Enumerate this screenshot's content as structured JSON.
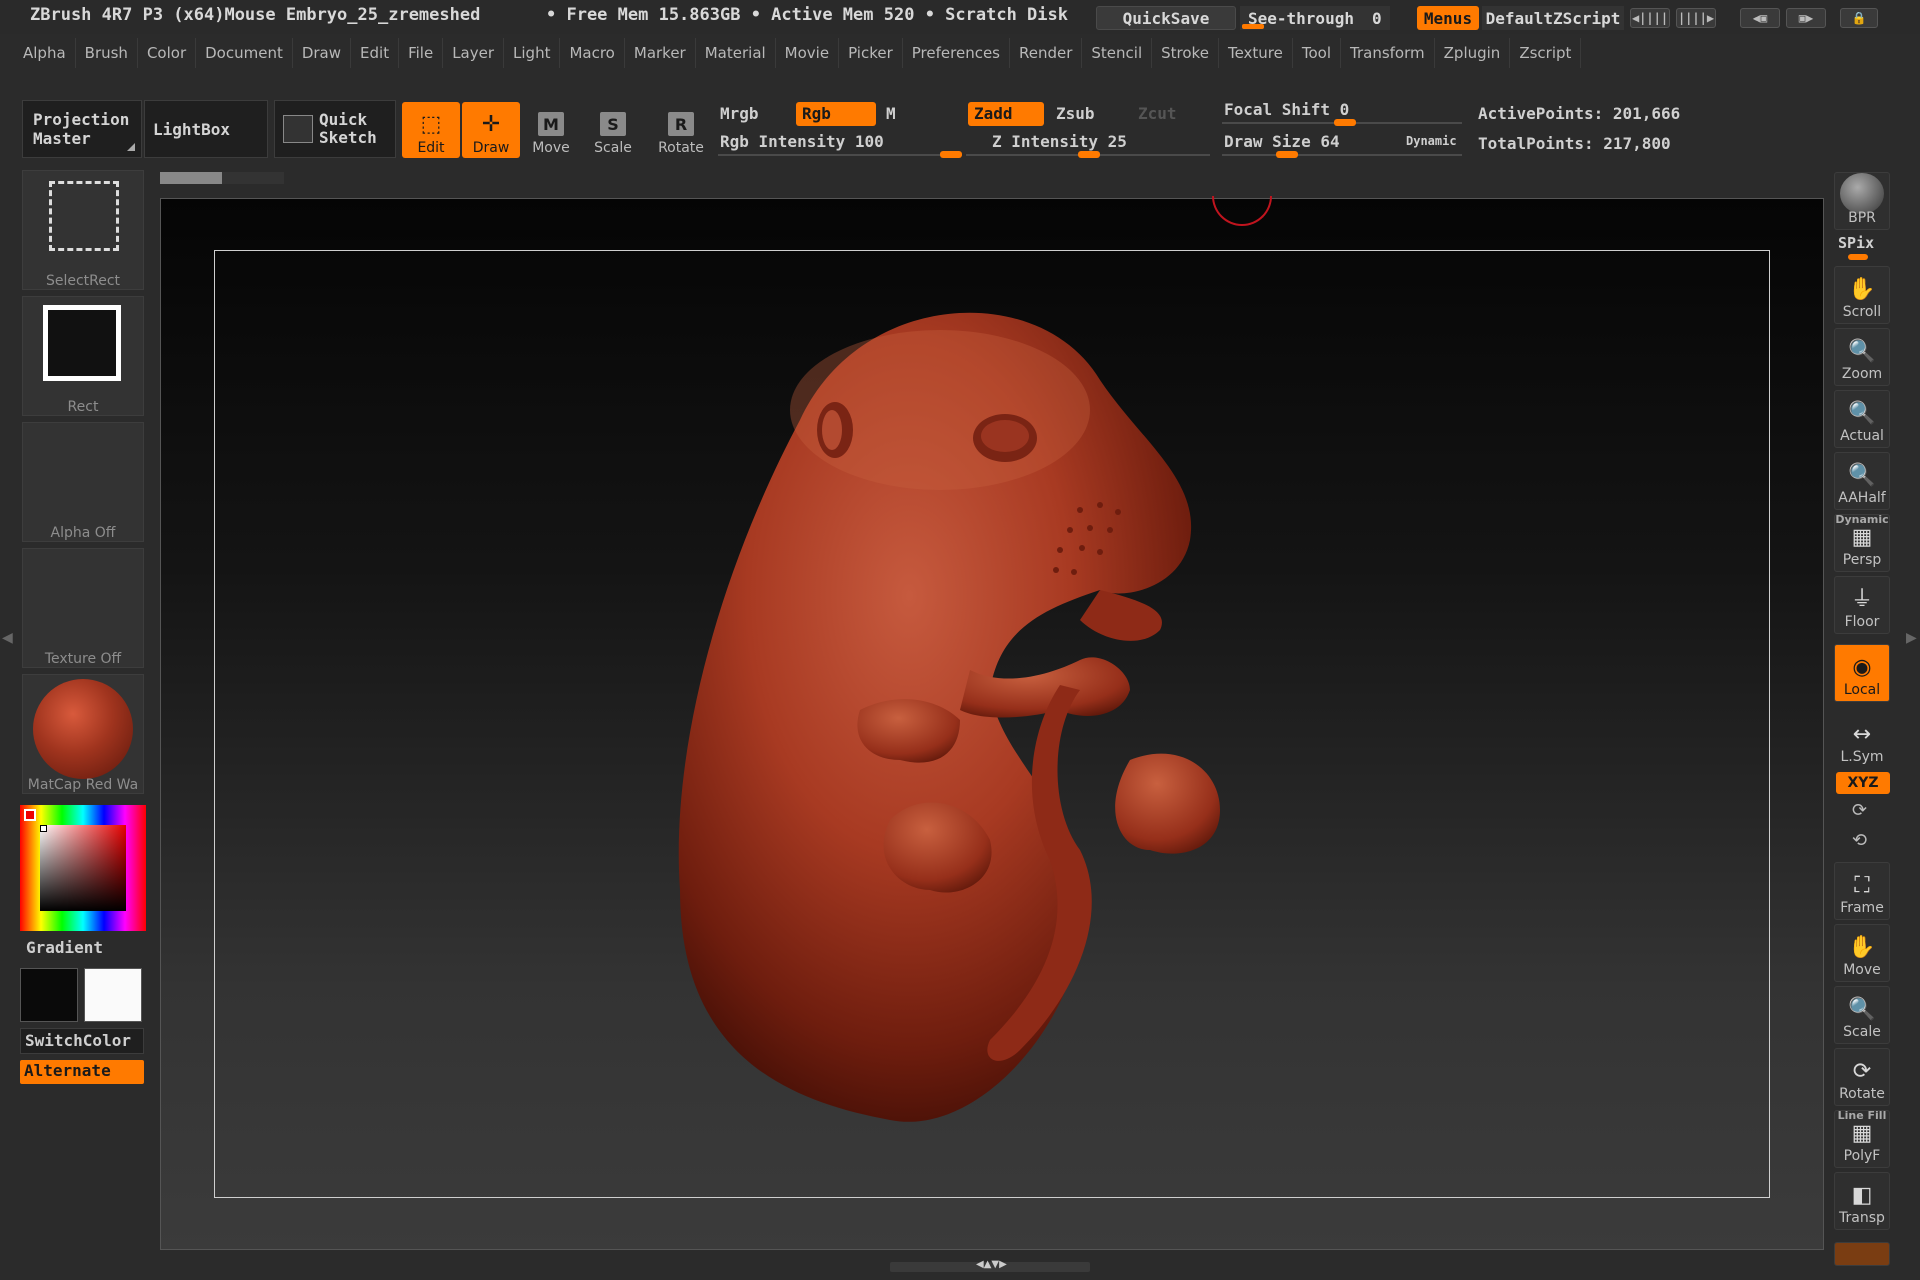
{
  "titlebar": {
    "app_title": "ZBrush 4R7 P3 (x64)Mouse Embryo_25_zremeshed",
    "memory": "• Free Mem 15.863GB • Active Mem 520 • Scratch Disk",
    "quicksave": "QuickSave",
    "see_through_label": "See-through",
    "see_through_value": "0",
    "menus": "Menus",
    "default_script": "DefaultZScript",
    "colors": {
      "accent": "#ff7a00",
      "background": "#2a2a2a"
    }
  },
  "menu": [
    "Alpha",
    "Brush",
    "Color",
    "Document",
    "Draw",
    "Edit",
    "File",
    "Layer",
    "Light",
    "Macro",
    "Marker",
    "Material",
    "Movie",
    "Picker",
    "Preferences",
    "Render",
    "Stencil",
    "Stroke",
    "Texture",
    "Tool",
    "Transform",
    "Zplugin",
    "Zscript"
  ],
  "shelf": {
    "projection_master": "Projection Master",
    "lightbox": "LightBox",
    "quick_sketch_1": "Quick",
    "quick_sketch_2": "Sketch",
    "tools": {
      "edit": "Edit",
      "draw": "Draw",
      "move": "Move",
      "move_letter": "M",
      "scale": "Scale",
      "scale_letter": "S",
      "rotate": "Rotate",
      "rotate_letter": "R"
    },
    "mrgb": "Mrgb",
    "rgb": "Rgb",
    "m": "M",
    "rgb_intensity": "Rgb Intensity 100",
    "zadd": "Zadd",
    "zsub": "Zsub",
    "zcut": "Zcut",
    "z_intensity": "Z Intensity 25",
    "focal_shift": "Focal Shift 0",
    "draw_size": "Draw Size 64",
    "dynamic": "Dynamic",
    "active_points": "ActivePoints: 201,666",
    "total_points": "TotalPoints: 217,800"
  },
  "left": {
    "select_rect": "SelectRect",
    "rect": "Rect",
    "alpha": "Alpha Off",
    "texture": "Texture Off",
    "matcap": "MatCap Red Wa",
    "gradient": "Gradient",
    "switch_color": "SwitchColor",
    "alternate": "Alternate",
    "main_color": "#e60000"
  },
  "right": {
    "bpr": "BPR",
    "spix": "SPix",
    "scroll": "Scroll",
    "zoom": "Zoom",
    "actual": "Actual",
    "aahalf": "AAHalf",
    "dynamic": "Dynamic",
    "persp": "Persp",
    "floor": "Floor",
    "local": "Local",
    "lsym": "L.Sym",
    "xyz": "XYZ",
    "frame": "Frame",
    "move": "Move",
    "scale": "Scale",
    "rotate": "Rotate",
    "line_fill": "Line Fill",
    "polyf": "PolyF",
    "transp": "Transp"
  },
  "model": {
    "material_color": "#a83a22"
  }
}
